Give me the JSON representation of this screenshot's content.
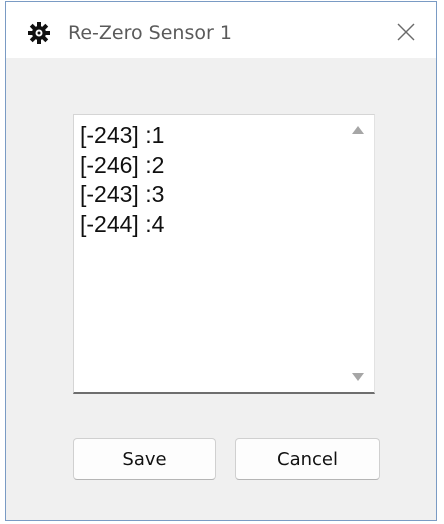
{
  "window": {
    "title": "Re-Zero Sensor 1",
    "icon": "gear-icon"
  },
  "list": {
    "items": [
      "[-243] :1",
      "[-246] :2",
      "[-243] :3",
      "[-244] :4"
    ]
  },
  "buttons": {
    "save_label": "Save",
    "cancel_label": "Cancel"
  },
  "colors": {
    "window_border": "#7a9bc4",
    "client_bg": "#f0f0f0",
    "titlebar_bg": "#ffffff"
  }
}
